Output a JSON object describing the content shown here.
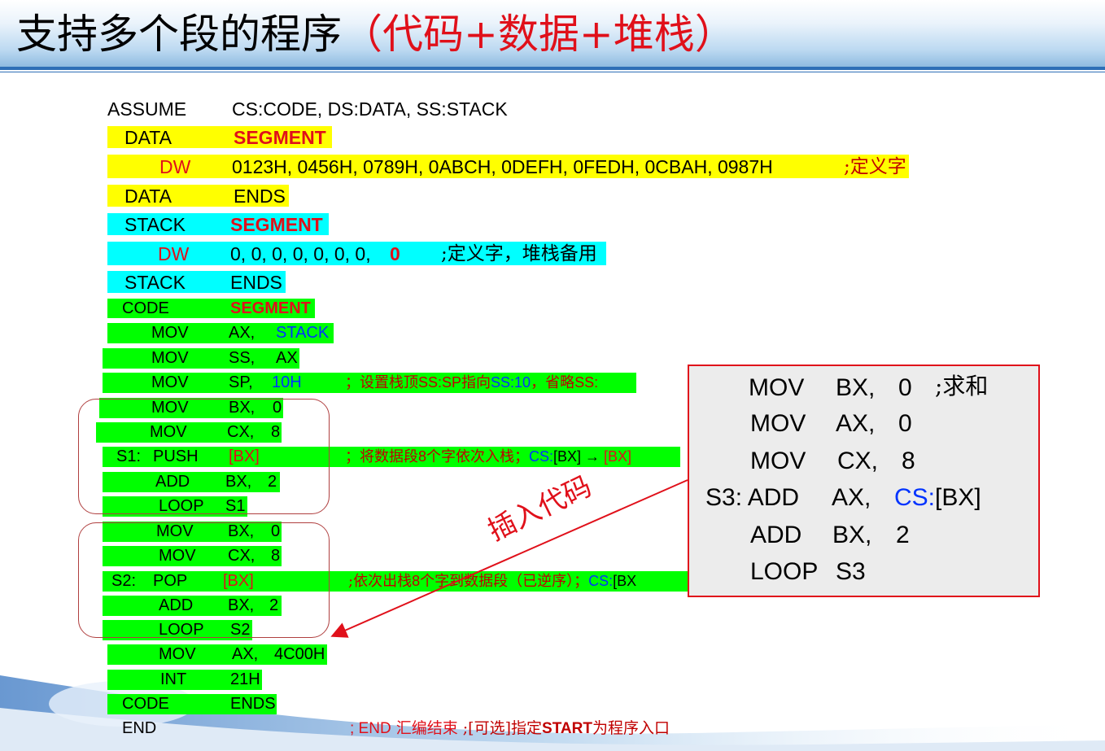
{
  "title": {
    "black": "支持多个段的程序",
    "red": "（代码+数据+堆栈）"
  },
  "code": {
    "assume": {
      "kw": "ASSUME",
      "args": "CS:CODE,  DS:DATA,  SS:STACK"
    },
    "data_segment": {
      "name": "DATA",
      "kw": "SEGMENT"
    },
    "data_dw": {
      "kw": "DW",
      "values": "0123H, 0456H, 0789H, 0ABCH, 0DEFH, 0FEDH, 0CBAH, 0987H",
      "comment": ";定义字"
    },
    "data_ends": {
      "name": "DATA",
      "kw": "ENDS"
    },
    "stack_segment": {
      "name": "STACK",
      "kw": "SEGMENT"
    },
    "stack_dw": {
      "kw": "DW",
      "values": "0, 0, 0, 0, 0, 0, 0,",
      "last": "0",
      "comment": ";定义字，堆栈备用"
    },
    "stack_ends": {
      "name": "STACK",
      "kw": "ENDS"
    },
    "code_segment": {
      "name": "CODE",
      "kw": "SEGMENT"
    },
    "mov_ax_stack": {
      "op": "MOV",
      "arg1": "AX,",
      "arg2": "STACK"
    },
    "mov_ss_ax": {
      "op": "MOV",
      "arg1": "SS,",
      "arg2": "AX"
    },
    "mov_sp_10h": {
      "op": "MOV",
      "arg1": "SP,",
      "arg2": "10H",
      "comment_a": "；设置栈顶",
      "comment_b": "SS:SP",
      "comment_c": "指向",
      "comment_d": "SS:10",
      "comment_e": "，省略",
      "comment_f": "SS:"
    },
    "mov_bx_0": {
      "op": "MOV",
      "arg1": "BX,",
      "arg2": "0"
    },
    "mov_cx_8": {
      "op": "MOV",
      "arg1": "CX,",
      "arg2": "8"
    },
    "s1_push": {
      "label": "S1:",
      "op": "PUSH",
      "arg": "[BX]",
      "comment_a": "；将数据段",
      "comment_b": "8",
      "comment_c": "个字依次入栈；",
      "comment_d": "CS:",
      "comment_e": "[BX] → ",
      "comment_f": "[BX]"
    },
    "add_bx_2_a": {
      "op": "ADD",
      "arg1": "BX,",
      "arg2": "2"
    },
    "loop_s1": {
      "op": "LOOP",
      "arg": "S1"
    },
    "mov_bx_0_b": {
      "op": "MOV",
      "arg1": "BX,",
      "arg2": "0"
    },
    "mov_cx_8_b": {
      "op": "MOV",
      "arg1": "CX,",
      "arg2": "8"
    },
    "s2_pop": {
      "label": "S2:",
      "op": "POP",
      "arg": "[BX]",
      "comment_a": ";依次出栈",
      "comment_b": "8",
      "comment_c": "个字到数据段（已逆序）；",
      "comment_d": "CS:",
      "comment_e": "[BX"
    },
    "add_bx_2_b": {
      "op": "ADD",
      "arg1": "BX,",
      "arg2": "2"
    },
    "loop_s2": {
      "op": "LOOP",
      "arg": "S2"
    },
    "mov_ax_4c00h": {
      "op": "MOV",
      "arg1": "AX,",
      "arg2": "4C00H"
    },
    "int_21h": {
      "op": "INT",
      "arg": "21H"
    },
    "code_ends": {
      "name": "CODE",
      "kw": "ENDS"
    },
    "end": {
      "kw": "END",
      "comment_a": "; END",
      "comment_b": " 汇编结束 ",
      "comment_c": "  ;[可选]指定",
      "comment_d": "START",
      "comment_e": "为程序入口"
    }
  },
  "popup": {
    "line1": {
      "op": "MOV",
      "arg1": "BX,",
      "arg2": "0",
      "comment": ";求和"
    },
    "line2": {
      "op": "MOV",
      "arg1": "AX,",
      "arg2": "0"
    },
    "line3": {
      "op": "MOV",
      "arg1": "CX,",
      "arg2": "8"
    },
    "line4": {
      "label": "S3: ADD",
      "arg1": "AX,",
      "arg2_blue": "CS:",
      "arg2_rest": "[BX]"
    },
    "line5": {
      "op": "ADD",
      "arg1": "BX,",
      "arg2": "2"
    },
    "line6": {
      "op": "LOOP",
      "arg": "S3"
    }
  },
  "annotation": "插入代码",
  "colors": {
    "red": "#e0101a",
    "yellow": "#ffff00",
    "cyan": "#00ffff",
    "green": "#00ff00",
    "blue": "#0033ff",
    "header_blue": "#2e6fb6"
  }
}
